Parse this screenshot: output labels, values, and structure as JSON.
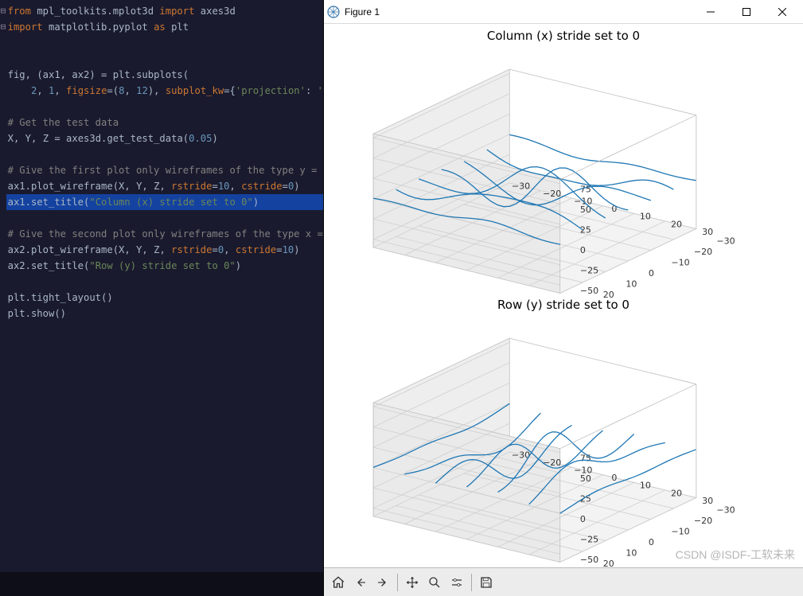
{
  "editor": {
    "lines": [
      {
        "type": "code",
        "seg": [
          [
            "kw",
            "from "
          ],
          [
            "fn",
            "mpl_toolkits.mplot3d "
          ],
          [
            "kw",
            "import "
          ],
          [
            "fn",
            "axes3d"
          ]
        ],
        "fold": true
      },
      {
        "type": "code",
        "seg": [
          [
            "kw",
            "import "
          ],
          [
            "fn",
            "matplotlib.pyplot "
          ],
          [
            "kw",
            "as "
          ],
          [
            "fn",
            "plt"
          ]
        ],
        "fold": true
      },
      {
        "type": "blank"
      },
      {
        "type": "blank"
      },
      {
        "type": "code",
        "seg": [
          [
            "fn",
            "fig"
          ],
          [
            "op",
            ", ("
          ],
          [
            "fn",
            "ax1"
          ],
          [
            "op",
            ", "
          ],
          [
            "fn",
            "ax2"
          ],
          [
            "op",
            ") = plt.subplots("
          ]
        ]
      },
      {
        "type": "code",
        "seg": [
          [
            "op",
            "    "
          ],
          [
            "num",
            "2"
          ],
          [
            "op",
            ", "
          ],
          [
            "num",
            "1"
          ],
          [
            "op",
            ", "
          ],
          [
            "pkw",
            "figsize"
          ],
          [
            "op",
            "=("
          ],
          [
            "num",
            "8"
          ],
          [
            "op",
            ", "
          ],
          [
            "num",
            "12"
          ],
          [
            "op",
            "), "
          ],
          [
            "pkw",
            "subplot_kw"
          ],
          [
            "op",
            "={"
          ],
          [
            "str",
            "'projection'"
          ],
          [
            "op",
            ": "
          ],
          [
            "str",
            "'"
          ]
        ]
      },
      {
        "type": "blank"
      },
      {
        "type": "code",
        "seg": [
          [
            "com",
            "# Get the test data"
          ]
        ]
      },
      {
        "type": "code",
        "seg": [
          [
            "fn",
            "X"
          ],
          [
            "op",
            ", "
          ],
          [
            "fn",
            "Y"
          ],
          [
            "op",
            ", "
          ],
          [
            "fn",
            "Z = axes3d.get_test_data("
          ],
          [
            "num",
            "0.05"
          ],
          [
            "op",
            ")"
          ]
        ]
      },
      {
        "type": "blank"
      },
      {
        "type": "code",
        "seg": [
          [
            "com",
            "# Give the first plot only wireframes of the type y ="
          ]
        ]
      },
      {
        "type": "code",
        "seg": [
          [
            "fn",
            "ax1.plot_wireframe(X"
          ],
          [
            "op",
            ", "
          ],
          [
            "fn",
            "Y"
          ],
          [
            "op",
            ", "
          ],
          [
            "fn",
            "Z"
          ],
          [
            "op",
            ", "
          ],
          [
            "pkw",
            "rstride"
          ],
          [
            "op",
            "="
          ],
          [
            "num",
            "10"
          ],
          [
            "op",
            ", "
          ],
          [
            "pkw",
            "cstride"
          ],
          [
            "op",
            "="
          ],
          [
            "num",
            "0"
          ],
          [
            "op",
            ")"
          ]
        ]
      },
      {
        "type": "code",
        "seg": [
          [
            "fn",
            "ax1.set_title("
          ],
          [
            "str",
            "\"Column (x) stride set to 0\""
          ],
          [
            "op",
            ")"
          ]
        ],
        "hl": true
      },
      {
        "type": "blank"
      },
      {
        "type": "code",
        "seg": [
          [
            "com",
            "# Give the second plot only wireframes of the type x ="
          ]
        ]
      },
      {
        "type": "code",
        "seg": [
          [
            "fn",
            "ax2.plot_wireframe(X"
          ],
          [
            "op",
            ", "
          ],
          [
            "fn",
            "Y"
          ],
          [
            "op",
            ", "
          ],
          [
            "fn",
            "Z"
          ],
          [
            "op",
            ", "
          ],
          [
            "pkw",
            "rstride"
          ],
          [
            "op",
            "="
          ],
          [
            "num",
            "0"
          ],
          [
            "op",
            ", "
          ],
          [
            "pkw",
            "cstride"
          ],
          [
            "op",
            "="
          ],
          [
            "num",
            "10"
          ],
          [
            "op",
            ")"
          ]
        ]
      },
      {
        "type": "code",
        "seg": [
          [
            "fn",
            "ax2.set_title("
          ],
          [
            "str",
            "\"Row (y) stride set to 0\""
          ],
          [
            "op",
            ")"
          ]
        ]
      },
      {
        "type": "blank"
      },
      {
        "type": "code",
        "seg": [
          [
            "fn",
            "plt.tight_layout()"
          ]
        ]
      },
      {
        "type": "code",
        "seg": [
          [
            "fn",
            "plt.show()"
          ]
        ]
      }
    ]
  },
  "figure": {
    "window_title": "Figure 1",
    "plot1_title": "Column (x) stride set to 0",
    "plot2_title": "Row (y) stride set to 0",
    "x_ticks": [
      "−30",
      "−20",
      "−10",
      "0",
      "10",
      "20",
      "30"
    ],
    "y_ticks": [
      "−30",
      "−20",
      "−10",
      "0",
      "10",
      "20",
      "30"
    ],
    "z_ticks": [
      "−50",
      "−25",
      "0",
      "25",
      "50",
      "75"
    ],
    "watermark": "CSDN @ISDF-工软未来"
  },
  "chart_data": [
    {
      "type": "3d-wireframe",
      "title": "Column (x) stride set to 0",
      "x_range": [
        -30,
        30
      ],
      "y_range": [
        -30,
        30
      ],
      "z_range": [
        -50,
        75
      ],
      "x_ticks": [
        -30,
        -20,
        -10,
        0,
        10,
        20,
        30
      ],
      "y_ticks": [
        -30,
        -20,
        -10,
        0,
        10,
        20,
        30
      ],
      "z_ticks": [
        -50,
        -25,
        0,
        25,
        50,
        75
      ],
      "rstride": 10,
      "cstride": 0,
      "source": "axes3d.get_test_data(0.05)",
      "color": "#1f77b4"
    },
    {
      "type": "3d-wireframe",
      "title": "Row (y) stride set to 0",
      "x_range": [
        -30,
        30
      ],
      "y_range": [
        -30,
        30
      ],
      "z_range": [
        -50,
        75
      ],
      "x_ticks": [
        -30,
        -20,
        -10,
        0,
        10,
        20,
        30
      ],
      "y_ticks": [
        -30,
        -20,
        -10,
        0,
        10,
        20,
        30
      ],
      "z_ticks": [
        -50,
        -25,
        0,
        25,
        50,
        75
      ],
      "rstride": 0,
      "cstride": 10,
      "source": "axes3d.get_test_data(0.05)",
      "color": "#1f77b4"
    }
  ],
  "toolbar": {
    "home": "Home",
    "back": "Back",
    "forward": "Forward",
    "pan": "Pan",
    "zoom": "Zoom",
    "subplots": "Configure subplots",
    "save": "Save"
  }
}
